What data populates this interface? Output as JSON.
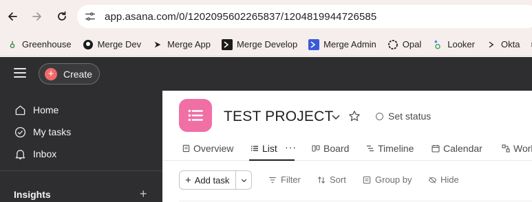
{
  "browser": {
    "url": "app.asana.com/0/1202095602265837/1204819944726585",
    "bookmarks": [
      {
        "label": "Greenhouse",
        "icon": "greenhouse-icon"
      },
      {
        "label": "Merge Dev",
        "icon": "github-icon"
      },
      {
        "label": "Merge App",
        "icon": "merge-arrow-icon"
      },
      {
        "label": "Merge Develop",
        "icon": "terminal-icon"
      },
      {
        "label": "Merge Admin",
        "icon": "merge-admin-icon"
      },
      {
        "label": "Opal",
        "icon": "opal-icon"
      },
      {
        "label": "Looker",
        "icon": "looker-icon"
      },
      {
        "label": "Okta",
        "icon": "okta-icon"
      }
    ]
  },
  "topbar": {
    "create_label": "Create"
  },
  "sidebar": {
    "items": [
      {
        "label": "Home",
        "icon": "home-icon"
      },
      {
        "label": "My tasks",
        "icon": "check-circle-icon"
      },
      {
        "label": "Inbox",
        "icon": "bell-icon"
      }
    ],
    "section_label": "Insights"
  },
  "project": {
    "title": "TEST PROJECT",
    "set_status_label": "Set status",
    "tabs": [
      {
        "label": "Overview",
        "icon": "overview-icon"
      },
      {
        "label": "List",
        "icon": "list-icon"
      },
      {
        "label": "Board",
        "icon": "board-icon"
      },
      {
        "label": "Timeline",
        "icon": "timeline-icon"
      },
      {
        "label": "Calendar",
        "icon": "calendar-icon"
      },
      {
        "label": "Workflow",
        "icon": "workflow-icon"
      }
    ],
    "more_label": "···",
    "toolbar": {
      "add_task_label": "Add task",
      "filter_label": "Filter",
      "sort_label": "Sort",
      "group_by_label": "Group by",
      "hide_label": "Hide"
    }
  },
  "colors": {
    "asana_dark": "#2e2e30",
    "project_icon": "#f06fa5",
    "create_plus": "#f06a6a",
    "chrome_bg": "#f5eeed"
  }
}
